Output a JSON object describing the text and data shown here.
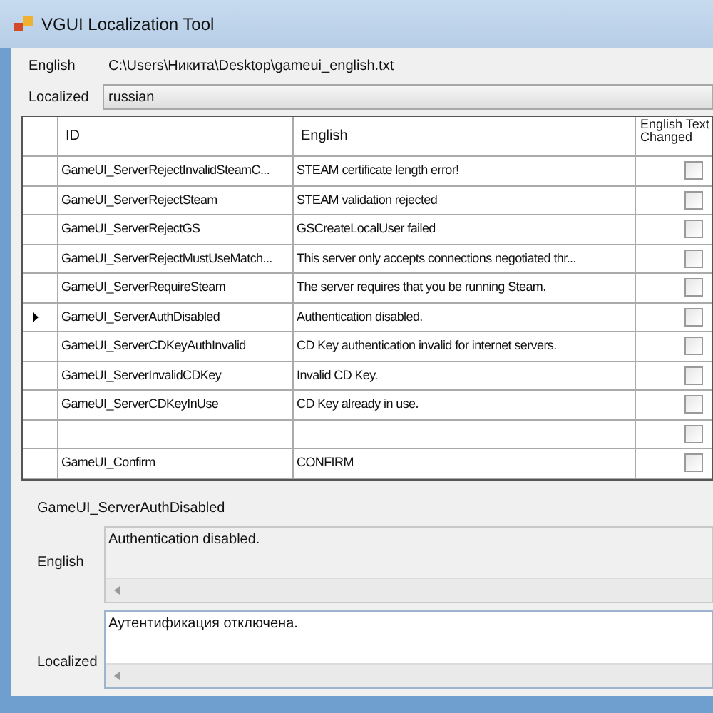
{
  "window": {
    "title": "VGUI Localization Tool"
  },
  "english_file": {
    "label": "English",
    "value": "C:\\Users\\Никита\\Desktop\\gameui_english.txt"
  },
  "localized_language": {
    "label": "Localized",
    "value": "russian"
  },
  "table": {
    "columns": [
      "ID",
      "English",
      "English Text Changed"
    ],
    "rows": [
      {
        "id": "GameUI_ServerRejectInvalidSteamC...",
        "english": "STEAM certificate length error!",
        "changed": false,
        "selected": false
      },
      {
        "id": "GameUI_ServerRejectSteam",
        "english": "STEAM validation rejected",
        "changed": false,
        "selected": false
      },
      {
        "id": "GameUI_ServerRejectGS",
        "english": "GSCreateLocalUser failed",
        "changed": false,
        "selected": false
      },
      {
        "id": "GameUI_ServerRejectMustUseMatch...",
        "english": "This server only accepts connections negotiated thr...",
        "changed": false,
        "selected": false
      },
      {
        "id": "GameUI_ServerRequireSteam",
        "english": "The server requires that you be running Steam.",
        "changed": false,
        "selected": false
      },
      {
        "id": "GameUI_ServerAuthDisabled",
        "english": "Authentication disabled.",
        "changed": false,
        "selected": true
      },
      {
        "id": "GameUI_ServerCDKeyAuthInvalid",
        "english": "CD Key authentication invalid for internet servers.",
        "changed": false,
        "selected": false
      },
      {
        "id": "GameUI_ServerInvalidCDKey",
        "english": "Invalid CD Key.",
        "changed": false,
        "selected": false
      },
      {
        "id": "GameUI_ServerCDKeyInUse",
        "english": "CD Key already in use.",
        "changed": false,
        "selected": false
      },
      {
        "changed": false,
        "selected": false
      },
      {
        "id": "GameUI_Confirm",
        "english": "CONFIRM",
        "changed": false,
        "selected": false
      }
    ]
  },
  "detail": {
    "id": "GameUI_ServerAuthDisabled",
    "english_label": "English",
    "english": "Authentication disabled.",
    "localized_label": "Localized",
    "localized": "Аутентификация отключена."
  }
}
